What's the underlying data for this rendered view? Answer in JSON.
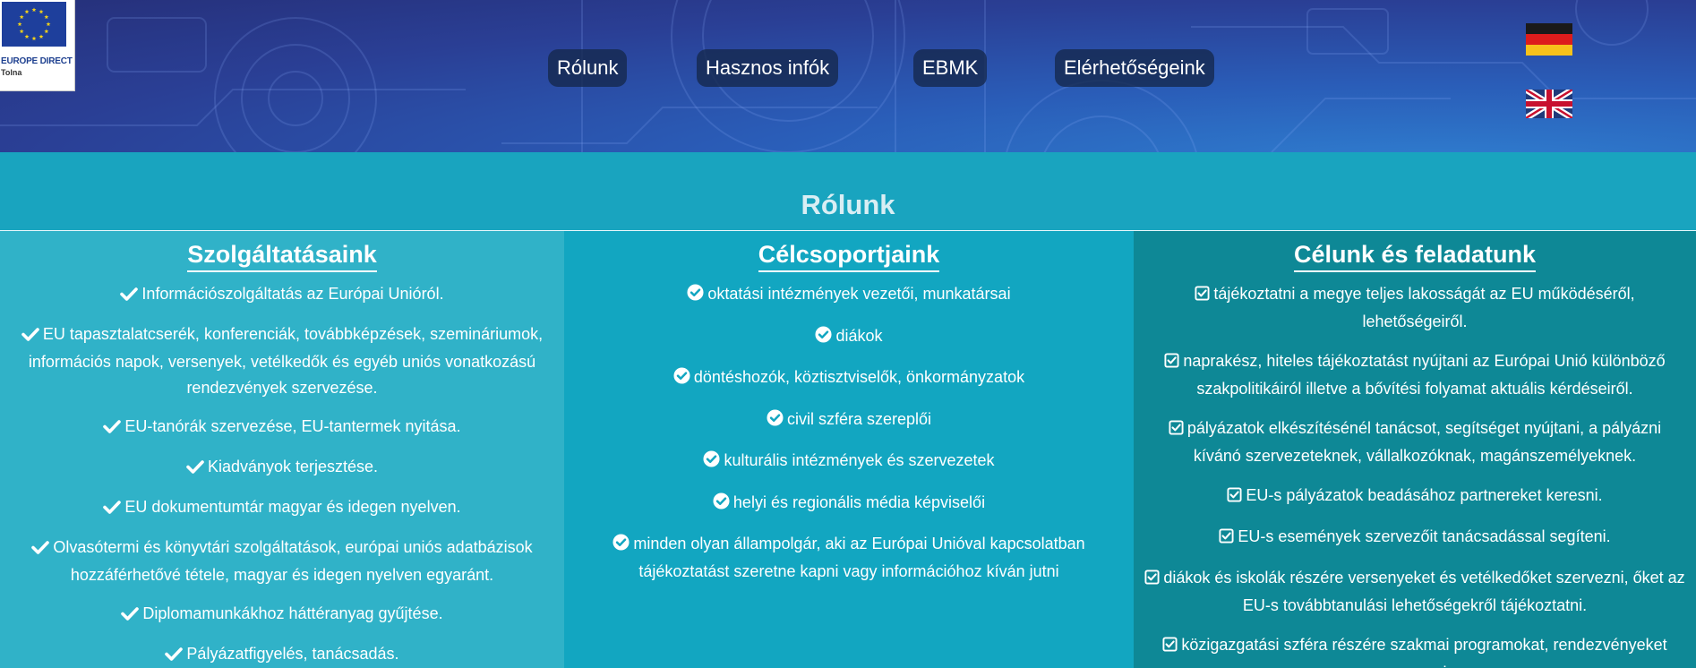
{
  "logo": {
    "name": "EUROPE DIRECT",
    "sub": "Tolna"
  },
  "nav": {
    "items": [
      "Rólunk",
      "Hasznos infók",
      "EBMK",
      "Elérhetőségeink"
    ]
  },
  "languages": [
    "german-flag",
    "english-flag"
  ],
  "page": {
    "title": "Rólunk"
  },
  "colors": {
    "header": "#2a3f95",
    "title_band": "#19a4bf",
    "col1": "#30b2c8",
    "col2": "#12a6c1",
    "col3": "#0e8896"
  },
  "columns": [
    {
      "title": "Szolgáltatásaink",
      "icon": "check-icon",
      "items": [
        "Információszolgáltatás az Európai Unióról.",
        "EU tapasztalatcserék, konferenciák, továbbképzések, szemináriumok, információs napok, versenyek, vetélkedők és egyéb uniós vonatkozású rendezvények szervezése.",
        "EU-tanórák szervezése, EU-tantermek nyitása.",
        "Kiadványok terjesztése.",
        "EU dokumentumtár magyar és idegen nyelven.",
        "Olvasótermi és könyvtári szolgáltatások, európai uniós adatbázisok hozzáférhetővé tétele, magyar és idegen nyelven egyaránt.",
        "Diplomamunkákhoz háttéranyag gyűjtése.",
        "Pályázatfigyelés, tanácsadás."
      ]
    },
    {
      "title": "Célcsoportjaink",
      "icon": "check-circle-icon",
      "items": [
        "oktatási intézmények vezetői, munkatársai",
        "diákok",
        "döntéshozók, köztisztviselők, önkormányzatok",
        "civil szféra szereplői",
        "kulturális intézmények és szervezetek",
        "helyi és regionális média képviselői",
        "minden olyan állampolgár, aki az Európai Unióval kapcsolatban tájékoztatást szeretne kapni vagy információhoz kíván jutni"
      ]
    },
    {
      "title": "Célunk és feladatunk",
      "icon": "checkbox-icon",
      "items": [
        "tájékoztatni a megye teljes lakosságát az EU működéséről, lehetőségeiről.",
        "naprakész, hiteles tájékoztatást nyújtani az Európai Unió különböző szakpolitikáiról illetve a bővítési folyamat aktuális kérdéseiről.",
        "pályázatok elkészítésénél tanácsot, segítséget nyújtani, a pályázni kívánó szervezeteknek, vállalkozóknak, magánszemélyeknek.",
        "EU-s pályázatok beadásához partnereket keresni.",
        "EU-s események szervezőit tanácsadással segíteni.",
        "diákok és iskolák részére versenyeket és vetélkedőket szervezni, őket az EU-s továbbtanulási lehetőségekről tájékoztatni.",
        "közigazgatási szféra részére szakmai programokat, rendezvényeket szervezni."
      ]
    }
  ]
}
